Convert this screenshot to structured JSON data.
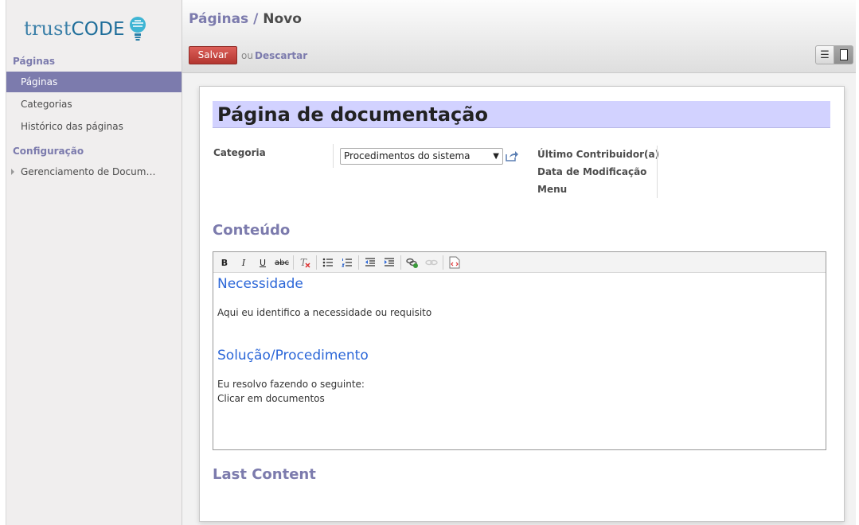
{
  "app": {
    "logo_text_light": "trust",
    "logo_text_bold": "CODE"
  },
  "sidebar": {
    "section1_title": "Páginas",
    "items": [
      {
        "label": "Páginas",
        "active": true
      },
      {
        "label": "Categorias",
        "active": false
      },
      {
        "label": "Histórico das páginas",
        "active": false
      }
    ],
    "section2_title": "Configuração",
    "config_items": [
      {
        "label": "Gerenciamento de Docum…"
      }
    ]
  },
  "header": {
    "breadcrumb_parent": "Páginas",
    "breadcrumb_separator": "/",
    "breadcrumb_current": "Novo",
    "save_label": "Salvar",
    "or_text": "ou",
    "discard_label": "Descartar"
  },
  "form": {
    "title": "Página de documentação",
    "category_label": "Categoria",
    "category_value": "Procedimentos do sistema",
    "last_contributor_label": "Último Contribuidor(a)",
    "modified_date_label": "Data de Modificação",
    "menu_label": "Menu",
    "content_section_title": "Conteúdo",
    "last_content_title": "Last Content"
  },
  "editor": {
    "toolbar": [
      "B",
      "I",
      "U",
      "abc"
    ],
    "heading1": "Necessidade",
    "paragraph1": "Aqui eu identifico a necessidade ou requisito",
    "heading2": "Solução/Procedimento",
    "paragraph2_line1": "Eu resolvo fazendo o seguinte:",
    "paragraph2_line2": "Clicar em documentos"
  },
  "colors": {
    "accent": "#7c7bad",
    "save_button": "#c33c36",
    "title_bg": "#d2d2ff",
    "heading_blue": "#2c67d8"
  }
}
